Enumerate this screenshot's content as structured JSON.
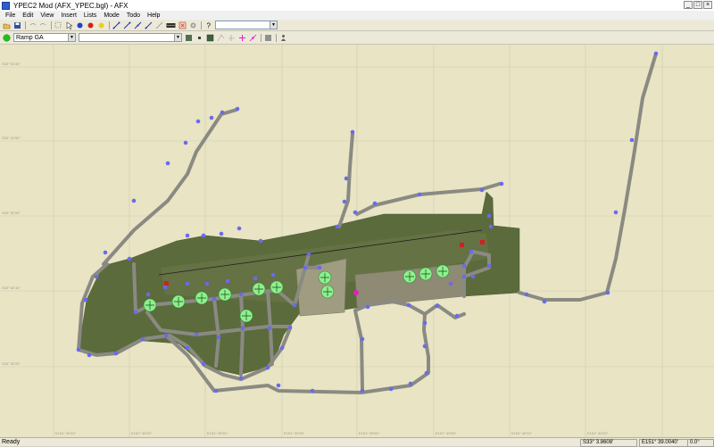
{
  "window": {
    "title": "YPEC2 Mod  (AFX_YPEC.bgl) - AFX"
  },
  "menu": [
    "File",
    "Edit",
    "View",
    "Insert",
    "Lists",
    "Mode",
    "Todo",
    "Help"
  ],
  "toolbar": {
    "icons": [
      "open-icon",
      "save-icon",
      "undo-icon",
      "redo-icon",
      "select-icon",
      "pointer-icon",
      "blue-dot-icon",
      "red-dot-icon",
      "yellow-dot-icon",
      "line-tool-icon",
      "line-tool-icon",
      "line-tool-icon",
      "line-tool-icon",
      "line-tool-icon",
      "runway-icon",
      "delete-icon",
      "gear-icon",
      "help-icon"
    ],
    "combo_value": ""
  },
  "toolbar2": {
    "layer_label": "Ramp GA",
    "object_value": "",
    "icons": [
      "square-icon",
      "square-icon",
      "fill-icon",
      "line-tool-icon",
      "line-tool-icon",
      "plus-icon",
      "pink-tool-icon",
      "square-icon",
      "person-icon"
    ]
  },
  "map": {
    "y_labels": [
      "S33° 51'40\"",
      "S33° 51'50\"",
      "S33° 52'00\"",
      "S33° 52'10\"",
      "S33° 52'20\""
    ],
    "x_labels": [
      "E151° 39'10\"",
      "E151° 39'20\"",
      "E151° 39'30\"",
      "E151° 39'40\"",
      "E151° 39'50\"",
      "E151° 40'00\"",
      "E151° 40'10\"",
      "E151° 40'20\""
    ]
  },
  "status": {
    "ready": "Ready",
    "lat": "S33° 3.8608'",
    "lon": "E151° 39.0040'",
    "heading": "0.0°"
  },
  "colors": {
    "grass": "#5b6b3c",
    "taxiway": "#8a8a82",
    "node": "#6a6aee",
    "runway": "#a09c82",
    "bg": "#e8e4c4"
  }
}
